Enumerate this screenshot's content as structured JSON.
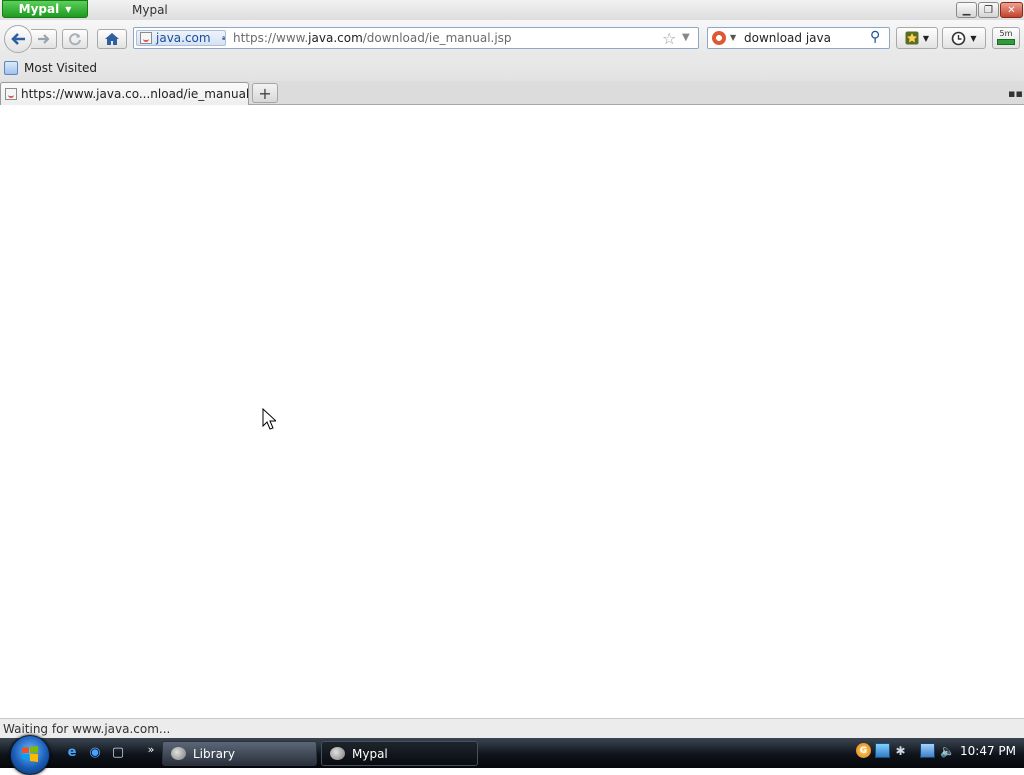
{
  "window": {
    "app_menu_label": "Mypal",
    "title": "Mypal"
  },
  "navbar": {
    "identity_label": "java.com",
    "url_prefix": "https://www.",
    "url_domain": "java.com",
    "url_path": "/download/ie_manual.jsp",
    "search_value": "download java",
    "search_engine_icon": "duckduckgo-icon",
    "addon_label": "5m"
  },
  "bookmarks_toolbar": {
    "items": [
      {
        "label": "Most Visited",
        "icon": "folder-icon"
      }
    ]
  },
  "tabs": [
    {
      "label": "https://www.java.co...nload/ie_manual.jsp",
      "active": true,
      "icon": "java-favicon"
    }
  ],
  "status": {
    "text": "Waiting for www.java.com..."
  },
  "taskbar": {
    "items": [
      {
        "label": "Library",
        "active": false
      },
      {
        "label": "Mypal",
        "active": true
      }
    ],
    "clock": "10:47 PM"
  },
  "colors": {
    "app_menu": "#2aa42a",
    "identity_text": "#1b4d9c",
    "taskbar": "#0f141b"
  }
}
